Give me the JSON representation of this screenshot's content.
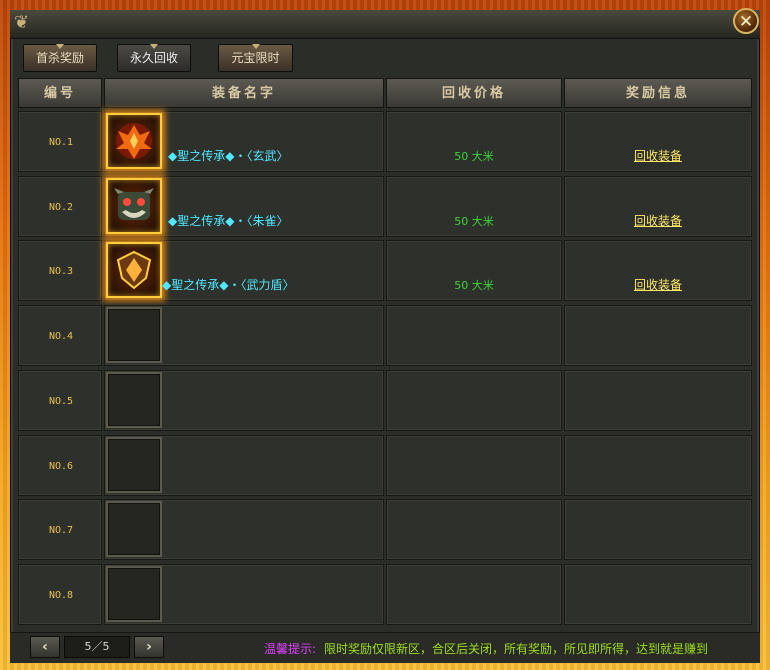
{
  "window": {
    "close_symbol": "✕"
  },
  "tabs": [
    {
      "label": "首杀奖励",
      "active": false
    },
    {
      "label": "永久回收",
      "active": true
    },
    {
      "label": "元宝限时",
      "active": false
    }
  ],
  "table": {
    "headers": [
      "编号",
      "装备名字",
      "回收价格",
      "奖励信息"
    ],
    "rows": [
      {
        "no": "NO.1",
        "item_icon": "phoenix-icon",
        "item_name": "◆聖之传承◆・〈玄武〉",
        "price": "50 大米",
        "reward": "回收装备"
      },
      {
        "no": "NO.2",
        "item_icon": "beast-mask-icon",
        "item_name": "◆聖之传承◆・〈朱雀〉",
        "price": "50 大米",
        "reward": "回收装备"
      },
      {
        "no": "NO.3",
        "item_icon": "shield-icon",
        "item_name": "◆聖之传承◆・〈武力盾〉",
        "price": "50 大米",
        "reward": "回收装备"
      },
      {
        "no": "NO.4",
        "item_icon": "",
        "item_name": "",
        "price": "",
        "reward": ""
      },
      {
        "no": "NO.5",
        "item_icon": "",
        "item_name": "",
        "price": "",
        "reward": ""
      },
      {
        "no": "NO.6",
        "item_icon": "",
        "item_name": "",
        "price": "",
        "reward": ""
      },
      {
        "no": "NO.7",
        "item_icon": "",
        "item_name": "",
        "price": "",
        "reward": ""
      },
      {
        "no": "NO.8",
        "item_icon": "",
        "item_name": "",
        "price": "",
        "reward": ""
      }
    ]
  },
  "pagination": {
    "prev_symbol": "‹",
    "next_symbol": "›",
    "page_text": "5／5"
  },
  "tip": {
    "label": "温馨提示:",
    "text": "限时奖励仅限新区，合区后关闭，所有奖励，所见即所得，达到就是赚到"
  },
  "colors": {
    "item_name": "#4fe8ff",
    "price": "#3ad43a",
    "reward": "#ffe86a",
    "row_number": "#e8c34d",
    "tip_label": "#e040ff",
    "tip_text": "#9cde1e"
  }
}
